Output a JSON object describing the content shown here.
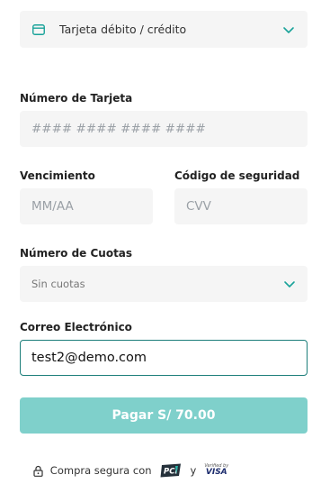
{
  "payment_method": {
    "selected": "Tarjeta débito / crédito",
    "icon": "credit-card-icon"
  },
  "card_number": {
    "label": "Número de Tarjeta",
    "placeholder": "#### #### #### ####",
    "value": ""
  },
  "expiry": {
    "label": "Vencimiento",
    "placeholder": "MM/AA",
    "value": ""
  },
  "cvv": {
    "label": "Código de seguridad",
    "placeholder": "CVV",
    "value": ""
  },
  "installments": {
    "label": "Número de Cuotas",
    "selected": "Sin cuotas"
  },
  "email": {
    "label": "Correo Electrónico",
    "value": "test2@demo.com"
  },
  "pay_button": {
    "label": "Pagar S/ 70.00"
  },
  "secure_footer": {
    "text": "Compra segura con",
    "pci_logo": "PCI",
    "conjunction": "y",
    "visa_verified_by": "Verified by",
    "visa_brand": "VISA"
  },
  "colors": {
    "accent": "#1c7e7a",
    "button_bg": "#7fd0cb",
    "chevron": "#1aa39a",
    "field_bg": "#f5f5f5"
  }
}
